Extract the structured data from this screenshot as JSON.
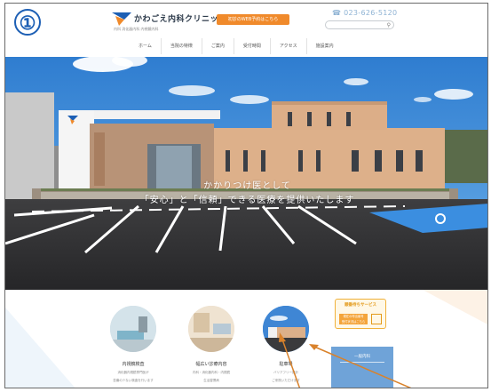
{
  "badge": {
    "label": "①"
  },
  "header": {
    "logo_name": "かわごえ内科クリニック",
    "logo_sub": "内科 消化器内科 内視鏡内科",
    "reserve_button": "初診のWEB予約はこちら",
    "phone": "☎ 023-626-5120",
    "search_placeholder": ""
  },
  "nav": {
    "items": [
      "ホーム",
      "当院の特徴",
      "ご案内",
      "受付時間",
      "アクセス",
      "施設案内"
    ]
  },
  "hero": {
    "tagline_line1": "かかりつけ医として",
    "tagline_line2": "「安心」と「信頼」できる医療を提供いたします"
  },
  "services": [
    {
      "title": "内視鏡検査",
      "desc1": "消化器内視鏡専門医が",
      "desc2": "苦痛の少ない検査を行います"
    },
    {
      "title": "幅広い診療内容",
      "desc1": "内科・消化器内科・内視鏡",
      "desc2": "生活習慣病"
    },
    {
      "title": "駐車場",
      "desc1": "バリアフリー設計",
      "desc2": "ご来院いただけます"
    }
  ],
  "notice": {
    "title": "順番待ちサービス",
    "text1": "現在の呼出番号",
    "text2": "受付状況はこちら"
  },
  "clinic_box": {
    "title": "一般内科"
  },
  "colors": {
    "brand_blue": "#1d5fb4",
    "accent_orange": "#f08a2b",
    "sky": "#3f86d4",
    "arrow": "#d9822b"
  }
}
